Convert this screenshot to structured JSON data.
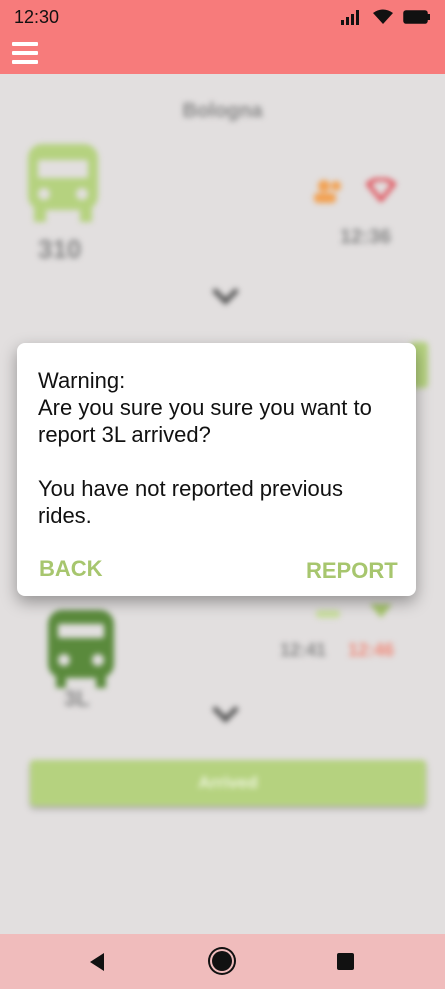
{
  "status_bar": {
    "time": "12:30",
    "icons": [
      "signal-icon",
      "wifi-icon",
      "battery-icon"
    ]
  },
  "app_bar": {
    "menu_icon": "hamburger-menu-icon"
  },
  "background": {
    "city": "Bologna",
    "ride1": {
      "route": "310",
      "time": "12:36"
    },
    "ride2": {
      "route": "3L",
      "scheduled_time": "12:41",
      "delayed_time": "12:46"
    },
    "arrived_label": "Arrived"
  },
  "dialog": {
    "message": "Warning:\nAre you sure you sure you want to report 3L arrived?\n\nYou have not reported previous rides.",
    "back_label": "BACK",
    "report_label": "REPORT"
  },
  "colors": {
    "accent": "#f77b7b",
    "action_green": "#a7c66e",
    "bus_green": "#b5d27f",
    "tram_green": "#5a8a3c"
  },
  "nav_bar": {
    "icons": [
      "back-icon",
      "home-icon",
      "recents-icon"
    ]
  }
}
